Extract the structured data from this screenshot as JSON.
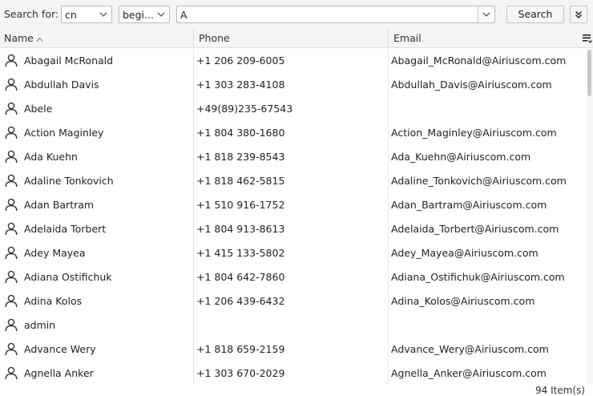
{
  "toolbar": {
    "search_for_label": "Search for:",
    "scope_value": "cn",
    "operator_value": "begi...",
    "query_value": "A",
    "search_button_label": "Search"
  },
  "columns": {
    "name": "Name",
    "phone": "Phone",
    "email": "Email"
  },
  "sort": {
    "column": "Name",
    "direction": "ascending"
  },
  "rows": [
    {
      "name": "Abagail McRonald",
      "phone": "+1 206 209-6005",
      "email": "Abagail_McRonald@Airiuscom.com"
    },
    {
      "name": "Abdullah Davis",
      "phone": "+1 303 283-4108",
      "email": "Abdullah_Davis@Airiuscom.com"
    },
    {
      "name": "Abele",
      "phone": "+49(89)235-67543",
      "email": ""
    },
    {
      "name": "Action Maginley",
      "phone": "+1 804 380-1680",
      "email": "Action_Maginley@Airiuscom.com"
    },
    {
      "name": "Ada Kuehn",
      "phone": "+1 818 239-8543",
      "email": "Ada_Kuehn@Airiuscom.com"
    },
    {
      "name": "Adaline Tonkovich",
      "phone": "+1 818 462-5815",
      "email": "Adaline_Tonkovich@Airiuscom.com"
    },
    {
      "name": "Adan Bartram",
      "phone": "+1 510 916-1752",
      "email": "Adan_Bartram@Airiuscom.com"
    },
    {
      "name": "Adelaida Torbert",
      "phone": "+1 804 913-8613",
      "email": "Adelaida_Torbert@Airiuscom.com"
    },
    {
      "name": "Adey Mayea",
      "phone": "+1 415 133-5802",
      "email": "Adey_Mayea@Airiuscom.com"
    },
    {
      "name": "Adiana Ostifichuk",
      "phone": "+1 804 642-7860",
      "email": "Adiana_Ostifichuk@Airiuscom.com"
    },
    {
      "name": "Adina Kolos",
      "phone": "+1 206 439-6432",
      "email": "Adina_Kolos@Airiuscom.com"
    },
    {
      "name": "admin",
      "phone": "",
      "email": ""
    },
    {
      "name": "Advance Wery",
      "phone": "+1 818 659-2159",
      "email": "Advance_Wery@Airiuscom.com"
    },
    {
      "name": "Agnella Anker",
      "phone": "+1 303 670-2029",
      "email": "Agnella_Anker@Airiuscom.com"
    }
  ],
  "status": {
    "item_count": "94 Item(s)"
  },
  "icons": {
    "row": "user-icon",
    "dropdown": "chevron-down-icon",
    "more": "double-chevron-down-icon",
    "column_picker": "column-chooser-icon",
    "sort": "sort-ascending-icon"
  },
  "colors": {
    "toolbar_bg": "#f4f4f4",
    "border": "#b9b9b9",
    "text": "#222222"
  }
}
